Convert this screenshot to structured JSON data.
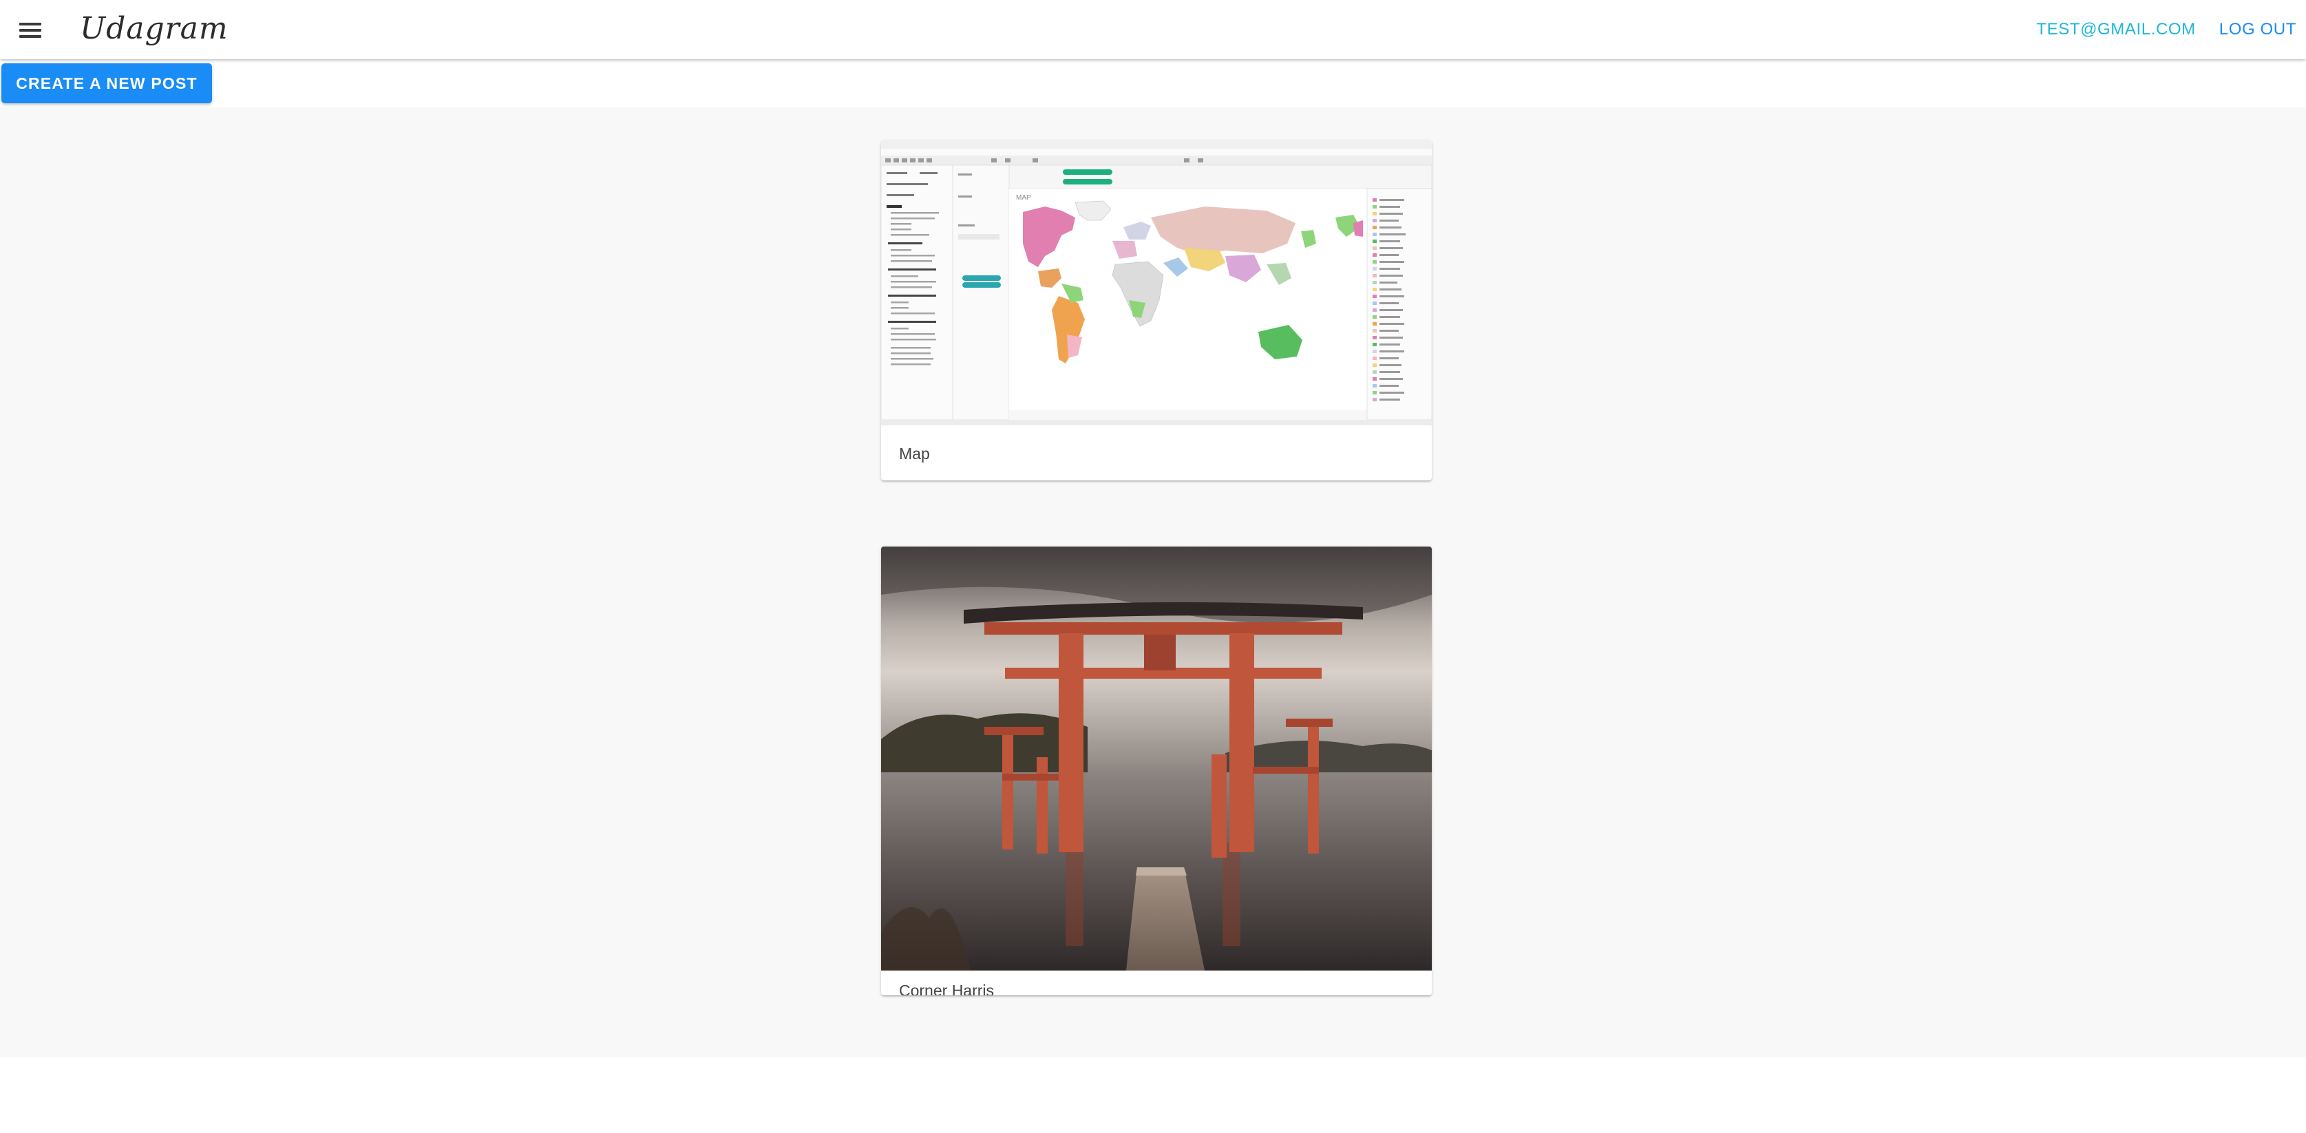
{
  "header": {
    "brand": "Udagram",
    "user_email": "TEST@GMAIL.COM",
    "logout_label": "LOG OUT",
    "menu_icon": "menu-icon"
  },
  "actions": {
    "create_post_label": "CREATE A NEW POST"
  },
  "feed": {
    "posts": [
      {
        "caption": "Map",
        "image": "software-map-screenshot"
      },
      {
        "caption": "Corner Harris",
        "image": "torii-gate-lake-photo"
      }
    ]
  },
  "colors": {
    "accent": "#1a8cf5",
    "email_link": "#1fb7d9",
    "logout_link": "#1a8cf5",
    "feed_bg": "#f8f8f8"
  }
}
